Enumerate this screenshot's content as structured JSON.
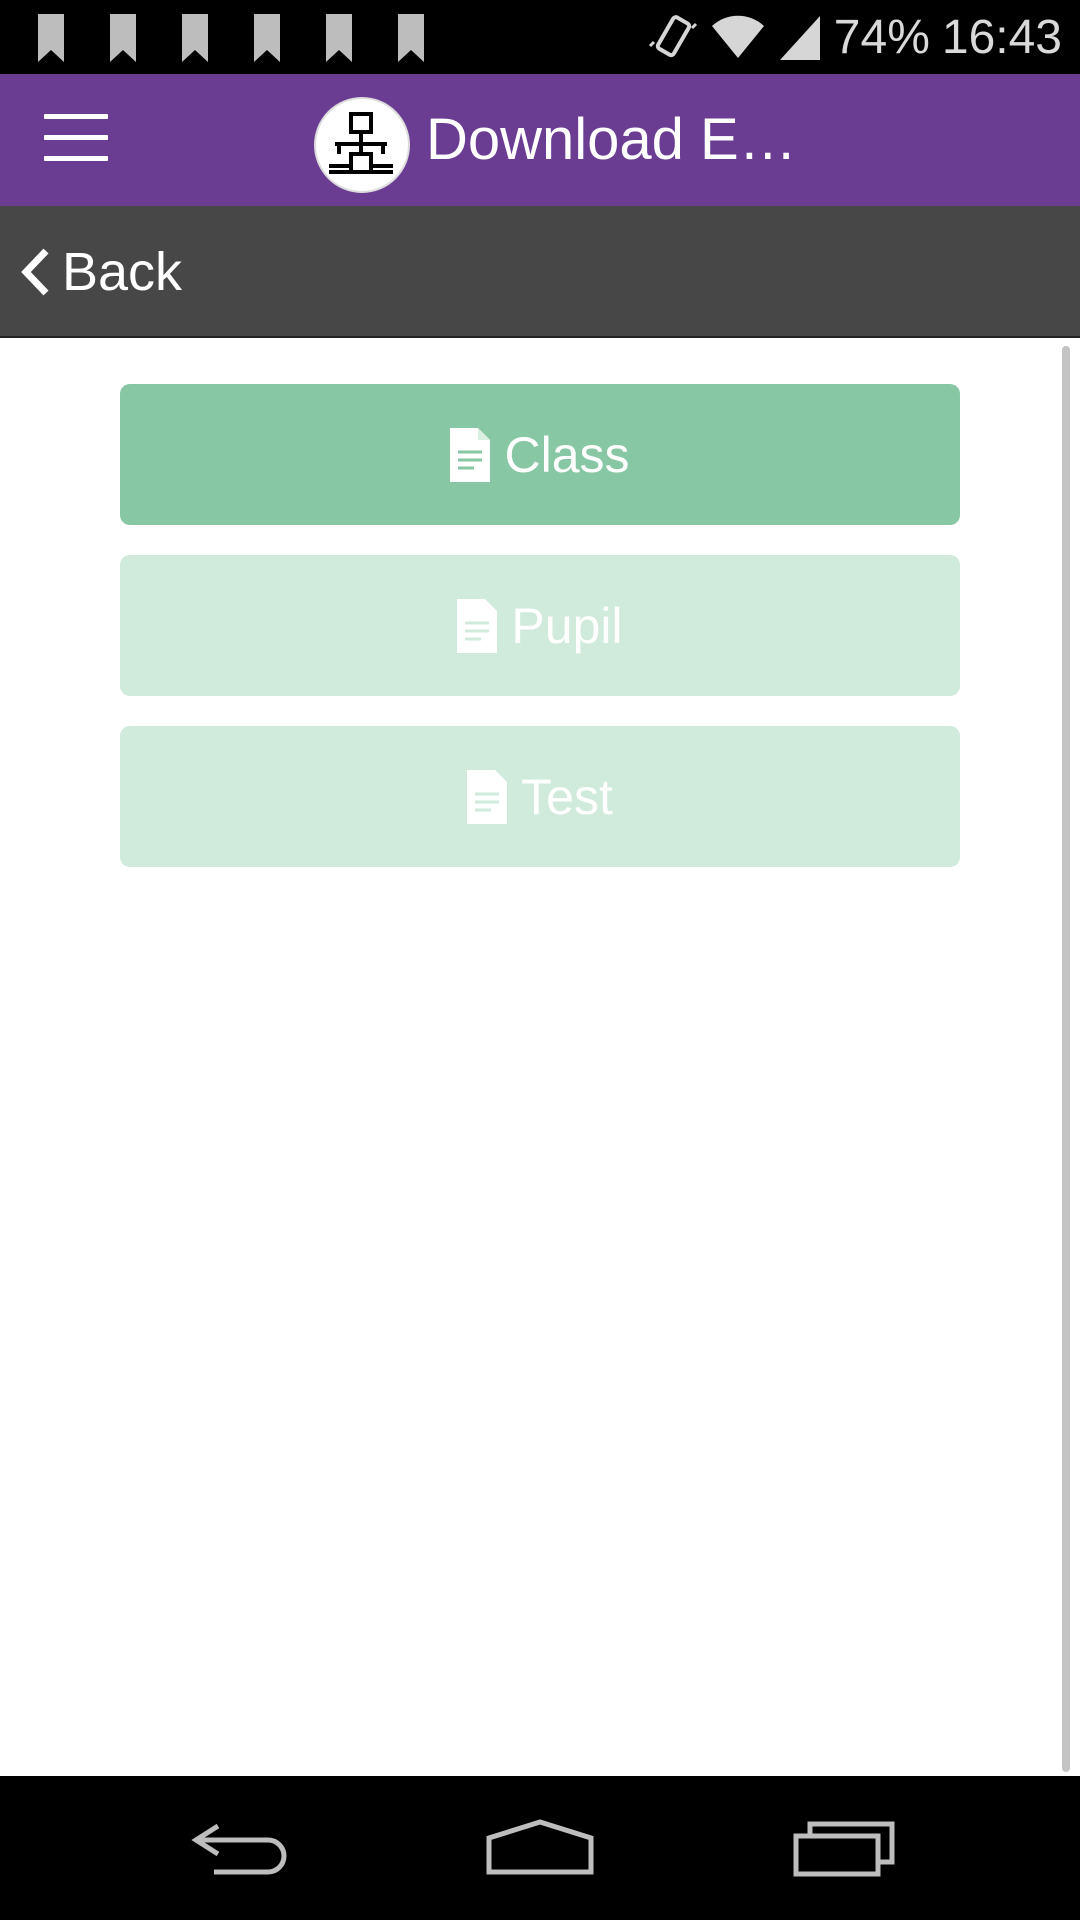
{
  "status_bar": {
    "notification_icons": [
      "bookmark-icon",
      "bookmark-icon",
      "bookmark-icon",
      "bookmark-icon",
      "bookmark-icon",
      "bookmark-icon"
    ],
    "battery": "74%",
    "time": "16:43"
  },
  "app_bar": {
    "title": "Download E…",
    "menu_icon": "hamburger-menu-icon",
    "logo_icon": "network-hierarchy-icon",
    "color": "#6a3d93"
  },
  "sub_bar": {
    "back_label": "Back"
  },
  "buttons": [
    {
      "label": "Class",
      "icon": "document-icon",
      "color": "#88c7a4",
      "state": "active"
    },
    {
      "label": "Pupil",
      "icon": "document-icon",
      "color": "#d0eadc",
      "state": "dimmed"
    },
    {
      "label": "Test",
      "icon": "document-icon",
      "color": "#d0eadc",
      "state": "dimmed"
    }
  ],
  "nav_bar": {
    "icons": [
      "back-nav-icon",
      "home-nav-icon",
      "recent-apps-icon"
    ]
  }
}
